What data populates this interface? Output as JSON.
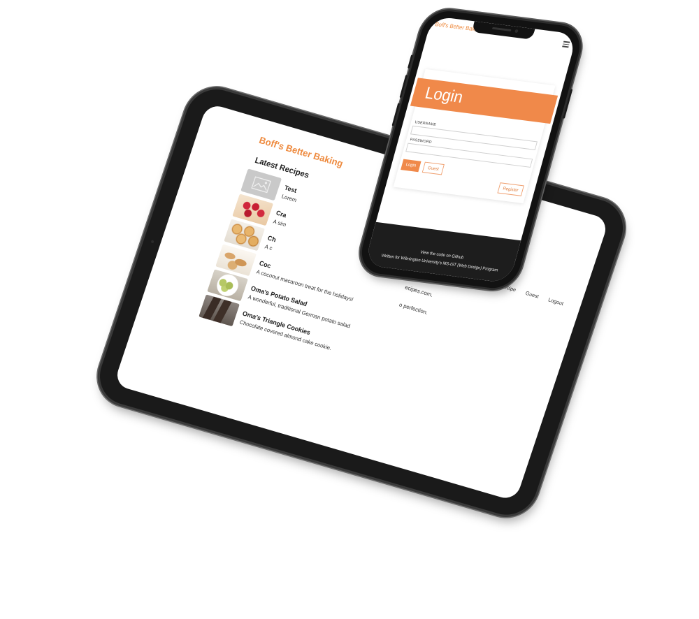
{
  "tablet": {
    "brand": "Boff's Better Baking",
    "section_title": "Latest Recipes",
    "nav": [
      "Create Recipe",
      "Guest",
      "Logout"
    ],
    "recipes": [
      {
        "name": "Test",
        "description": "Lorem"
      },
      {
        "name": "Cra",
        "description": "A sim"
      },
      {
        "name": "Ch",
        "description": "A c"
      },
      {
        "name": "Coc",
        "description": "A coconut macaroon treat for the holidays!"
      },
      {
        "name": "Oma's Potato Salad",
        "description": "A wonderful, traditional German potato salad"
      },
      {
        "name": "Oma's Triangle Cookies",
        "description": "Chocolate covered almond cake cookie."
      }
    ],
    "clipped_text": [
      "ecipes.com.",
      "o perfection."
    ]
  },
  "phone": {
    "brand": "Boff's Better Baking",
    "login_title": "Login",
    "username_label": "USERNAME",
    "password_label": "PASSWORD",
    "login_button": "Login",
    "guest_button": "Guest",
    "register_button": "Register",
    "footer_line1": "View the code on Github",
    "footer_line2": "Written for Wilmington University's MS-IST (Web Design) Program"
  },
  "icons": {
    "placeholder": "image-placeholder-icon",
    "menu": "hamburger-menu-icon"
  },
  "colors": {
    "accent": "#f0894a",
    "device_frame": "#1a1a1a",
    "footer_bg": "#1d1d1d"
  }
}
